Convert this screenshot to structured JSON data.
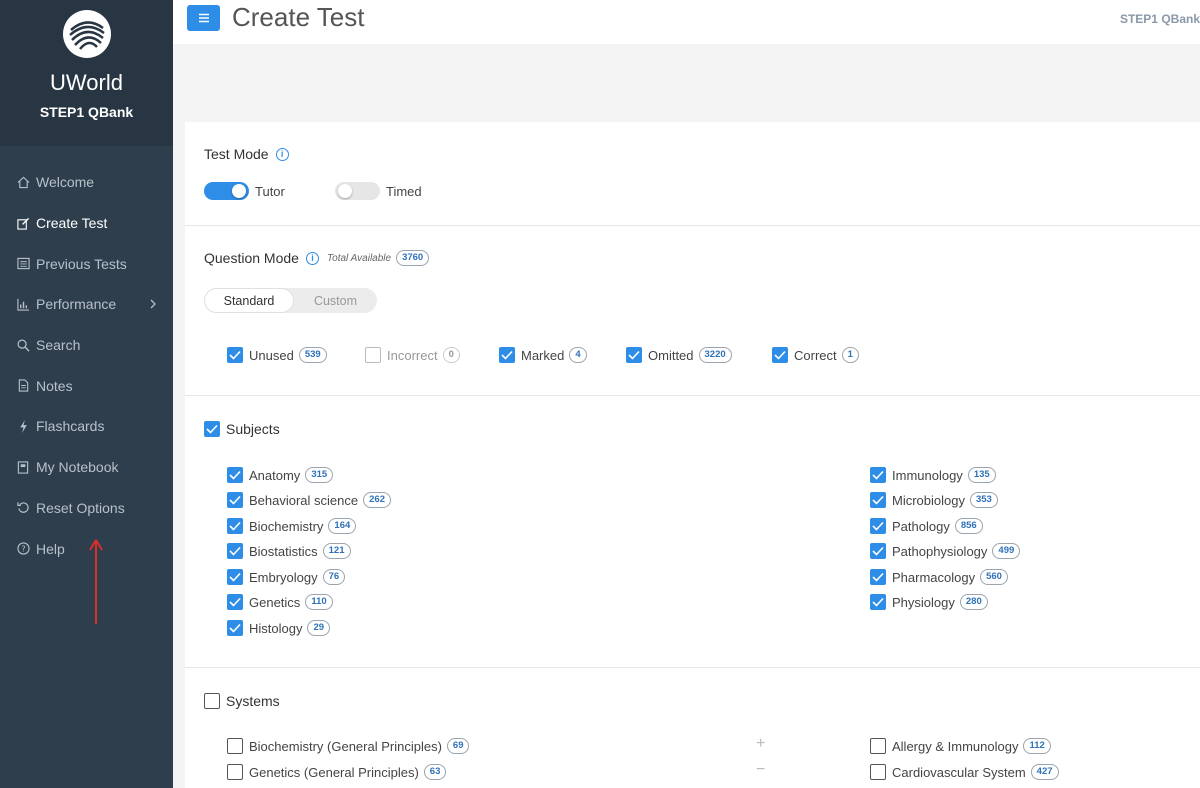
{
  "app": {
    "brand_name": "UWorld",
    "brand_sub": "STEP1 QBank",
    "qbank_label": "STEP1 QBank",
    "page_title": "Create Test",
    "accent_color": "#2e8de6",
    "sidebar_color": "#2f3e4c"
  },
  "sidebar": {
    "items": [
      {
        "label": "Welcome",
        "icon": "home-icon"
      },
      {
        "label": "Create Test",
        "icon": "edit-icon"
      },
      {
        "label": "Previous Tests",
        "icon": "list-icon"
      },
      {
        "label": "Performance",
        "icon": "chart-icon"
      },
      {
        "label": "Search",
        "icon": "search-icon"
      },
      {
        "label": "Notes",
        "icon": "note-icon"
      },
      {
        "label": "Flashcards",
        "icon": "bolt-icon"
      },
      {
        "label": "My Notebook",
        "icon": "notebook-icon"
      },
      {
        "label": "Reset Options",
        "icon": "reset-icon"
      },
      {
        "label": "Help",
        "icon": "help-icon"
      }
    ]
  },
  "test_mode": {
    "title": "Test Mode",
    "tutor_label": "Tutor",
    "tutor_on": true,
    "timed_label": "Timed",
    "timed_on": false
  },
  "question_mode": {
    "title": "Question Mode",
    "total_label": "Total Available",
    "total_count": "3760",
    "tabs": [
      "Standard",
      "Custom"
    ],
    "active_tab": "Standard",
    "filters": [
      {
        "label": "Unused",
        "count": "539",
        "checked": true
      },
      {
        "label": "Incorrect",
        "count": "0",
        "checked": false,
        "disabled": true
      },
      {
        "label": "Marked",
        "count": "4",
        "checked": true
      },
      {
        "label": "Omitted",
        "count": "3220",
        "checked": true
      },
      {
        "label": "Correct",
        "count": "1",
        "checked": true
      }
    ]
  },
  "subjects": {
    "title": "Subjects",
    "checked": true,
    "left": [
      {
        "label": "Anatomy",
        "count": "315"
      },
      {
        "label": "Behavioral science",
        "count": "262"
      },
      {
        "label": "Biochemistry",
        "count": "164"
      },
      {
        "label": "Biostatistics",
        "count": "121"
      },
      {
        "label": "Embryology",
        "count": "76"
      },
      {
        "label": "Genetics",
        "count": "110"
      },
      {
        "label": "Histology",
        "count": "29"
      }
    ],
    "right": [
      {
        "label": "Immunology",
        "count": "135"
      },
      {
        "label": "Microbiology",
        "count": "353"
      },
      {
        "label": "Pathology",
        "count": "856"
      },
      {
        "label": "Pathophysiology",
        "count": "499"
      },
      {
        "label": "Pharmacology",
        "count": "560"
      },
      {
        "label": "Physiology",
        "count": "280"
      }
    ]
  },
  "systems": {
    "title": "Systems",
    "checked": false,
    "left": [
      {
        "label": "Biochemistry (General Principles)",
        "count": "69"
      },
      {
        "label": "Genetics (General Principles)",
        "count": "63"
      }
    ],
    "right": [
      {
        "label": "Allergy & Immunology",
        "count": "112"
      },
      {
        "label": "Cardiovascular System",
        "count": "427"
      }
    ],
    "plus": "+",
    "minus": "−"
  }
}
